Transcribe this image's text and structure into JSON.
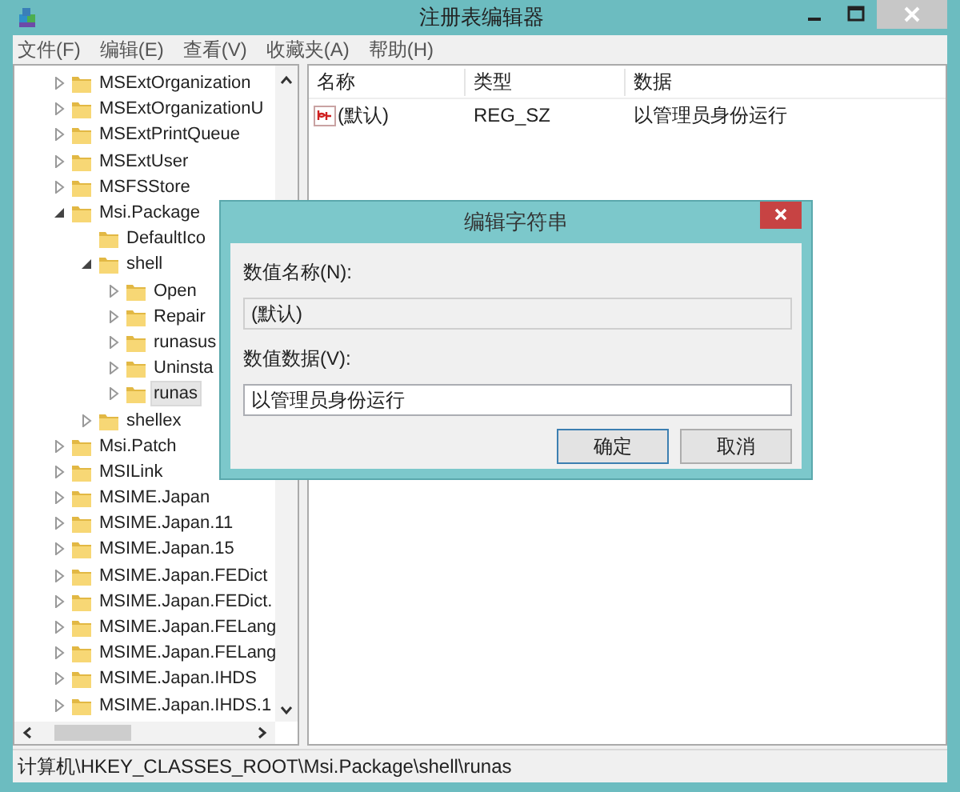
{
  "window": {
    "title": "注册表编辑器"
  },
  "menu": [
    "文件(F)",
    "编辑(E)",
    "查看(V)",
    "收藏夹(A)",
    "帮助(H)"
  ],
  "tree": [
    {
      "label": "MSExtOrganization",
      "kind": "key",
      "expanded": false,
      "selected": false
    },
    {
      "label": "MSExtOrganizationU",
      "kind": "key",
      "expanded": false,
      "selected": false
    },
    {
      "label": "MSExtPrintQueue",
      "kind": "key",
      "expanded": false,
      "selected": false
    },
    {
      "label": "MSExtUser",
      "kind": "key",
      "expanded": false,
      "selected": false
    },
    {
      "label": "MSFSStore",
      "kind": "key",
      "expanded": false,
      "selected": false
    },
    {
      "label": "Msi.Package",
      "kind": "key",
      "expanded": true,
      "selected": false,
      "children": [
        {
          "label": "DefaultIco",
          "kind": "leaf",
          "selected": false
        },
        {
          "label": "shell",
          "kind": "key",
          "expanded": true,
          "selected": false,
          "children": [
            {
              "label": "Open",
              "kind": "key",
              "expanded": false,
              "selected": false
            },
            {
              "label": "Repair",
              "kind": "key",
              "expanded": false,
              "selected": false
            },
            {
              "label": "runasus",
              "kind": "key",
              "expanded": false,
              "selected": false
            },
            {
              "label": "Uninsta",
              "kind": "key",
              "expanded": false,
              "selected": false
            },
            {
              "label": "runas",
              "kind": "key",
              "expanded": false,
              "selected": true
            }
          ]
        },
        {
          "label": "shellex",
          "kind": "key",
          "expanded": false,
          "selected": false
        }
      ]
    },
    {
      "label": "Msi.Patch",
      "kind": "key",
      "expanded": false,
      "selected": false
    },
    {
      "label": "MSILink",
      "kind": "key",
      "expanded": false,
      "selected": false
    },
    {
      "label": "MSIME.Japan",
      "kind": "key",
      "expanded": false,
      "selected": false
    },
    {
      "label": "MSIME.Japan.11",
      "kind": "key",
      "expanded": false,
      "selected": false
    },
    {
      "label": "MSIME.Japan.15",
      "kind": "key",
      "expanded": false,
      "selected": false
    },
    {
      "label": "MSIME.Japan.FEDict",
      "kind": "key",
      "expanded": false,
      "selected": false
    },
    {
      "label": "MSIME.Japan.FEDict.",
      "kind": "key",
      "expanded": false,
      "selected": false
    },
    {
      "label": "MSIME.Japan.FELang",
      "kind": "key",
      "expanded": false,
      "selected": false
    },
    {
      "label": "MSIME.Japan.FELang",
      "kind": "key",
      "expanded": false,
      "selected": false
    },
    {
      "label": "MSIME.Japan.IHDS",
      "kind": "key",
      "expanded": false,
      "selected": false
    },
    {
      "label": "MSIME.Japan.IHDS.1",
      "kind": "key",
      "expanded": false,
      "selected": false
    }
  ],
  "list": {
    "columns": [
      "名称",
      "类型",
      "数据"
    ],
    "rows": [
      {
        "name": "(默认)",
        "type": "REG_SZ",
        "data": "以管理员身份运行"
      }
    ]
  },
  "dialog": {
    "title": "编辑字符串",
    "name_label": "数值名称(N):",
    "name_value": "(默认)",
    "name_disabled": true,
    "data_label": "数值数据(V):",
    "data_value": "以管理员身份运行",
    "buttons": [
      {
        "label": "确定",
        "default": true
      },
      {
        "label": "取消",
        "default": false
      }
    ]
  },
  "status_bar": "计算机\\HKEY_CLASSES_ROOT\\Msi.Package\\shell\\runas"
}
